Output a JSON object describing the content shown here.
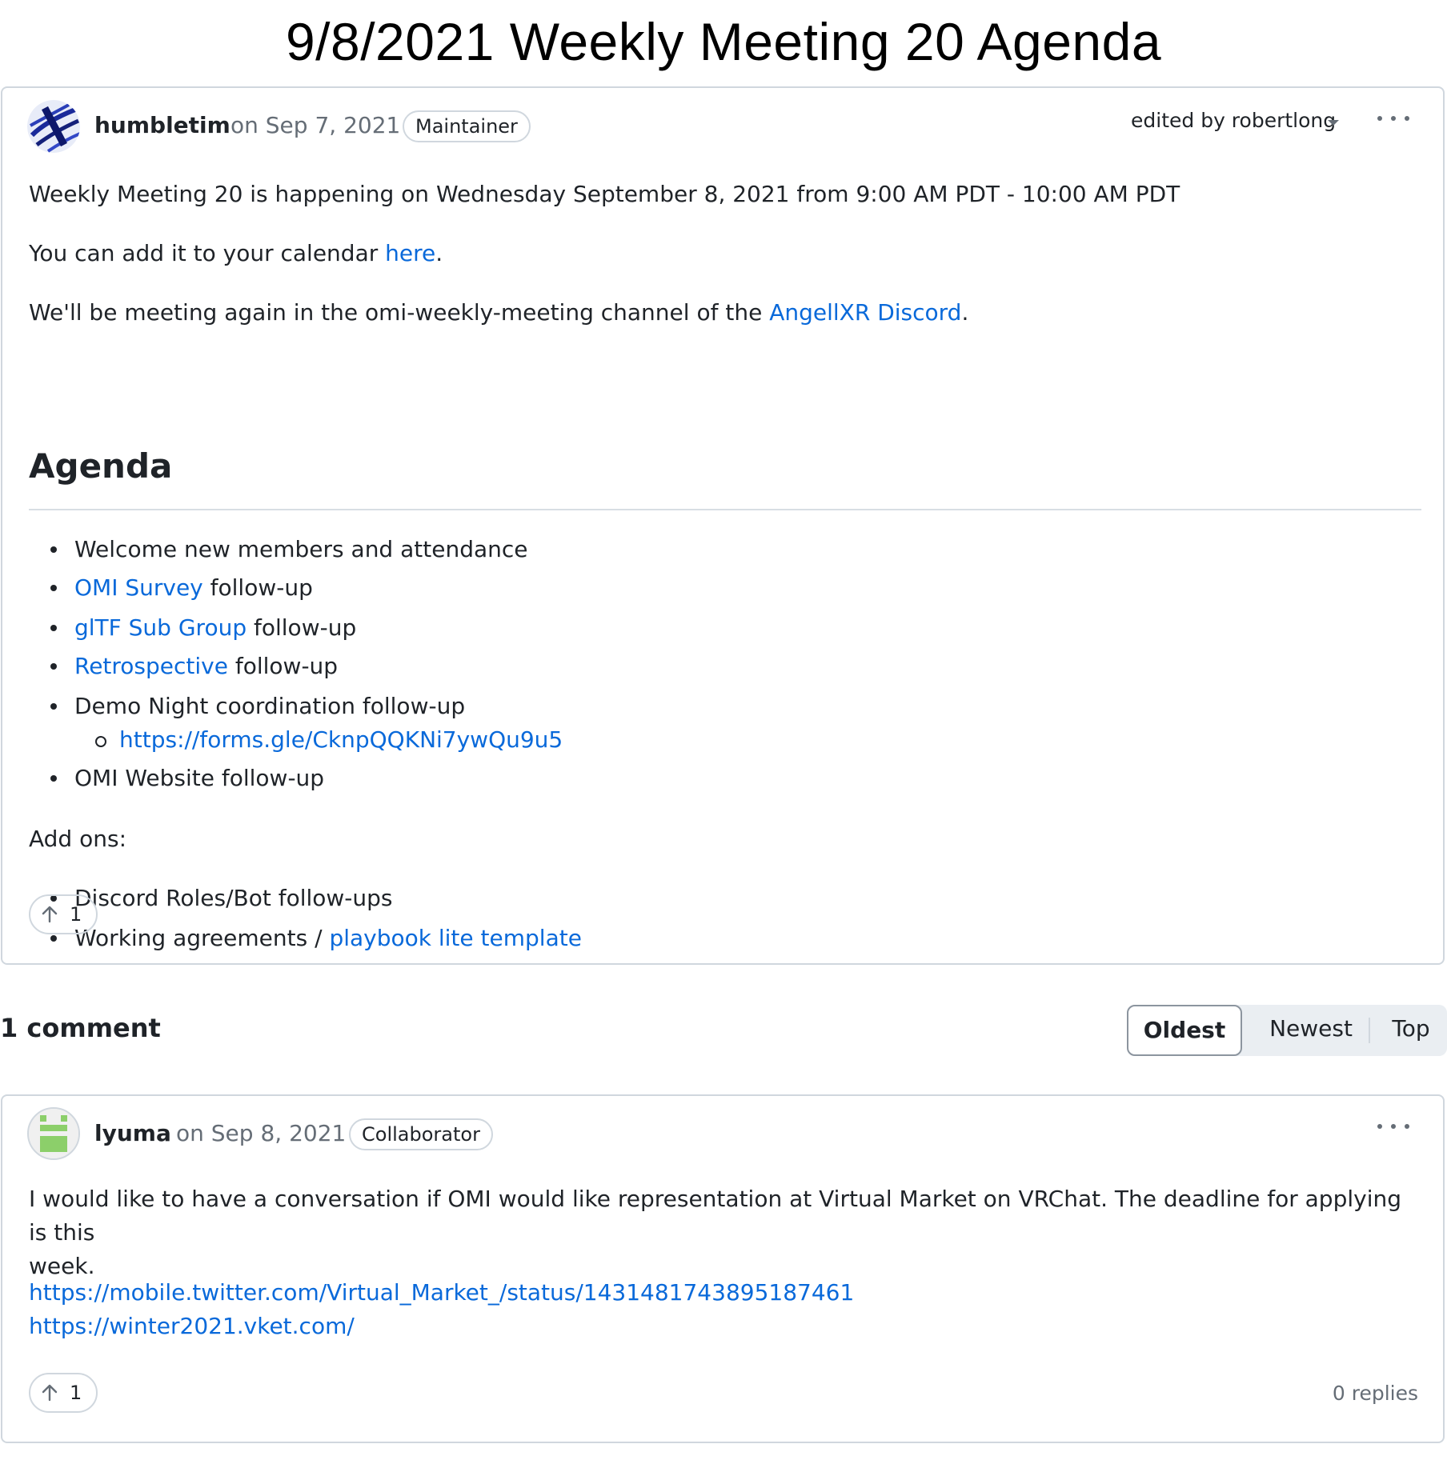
{
  "page": {
    "title": "9/8/2021 Weekly Meeting 20 Agenda"
  },
  "post": {
    "author": "humbletim",
    "date": "on Sep 7, 2021",
    "role": "Maintainer",
    "edited_by": "edited by robertlong",
    "intro": "Weekly Meeting 20 is happening on Wednesday September 8, 2021 from 9:00 AM PDT - 10:00 AM PDT",
    "calendar_text": "You can add it to your calendar ",
    "calendar_link": "here",
    "calendar_end": ".",
    "channel_text": "We'll be meeting again in the omi-weekly-meeting channel of the ",
    "channel_link": "AngellXR Discord",
    "channel_end": ".",
    "agenda_heading": "Agenda",
    "agenda": [
      {
        "text": "Welcome new members and attendance"
      },
      {
        "link": "OMI Survey",
        "text": " follow-up"
      },
      {
        "link": "glTF Sub Group",
        "text": " follow-up"
      },
      {
        "link": "Retrospective",
        "text": " follow-up"
      },
      {
        "text": "Demo Night coordination follow-up",
        "sub_link": "https://forms.gle/CknpQQKNi7ywQu9u5"
      },
      {
        "text": "OMI Website follow-up"
      }
    ],
    "addons_label": "Add ons:",
    "addons": [
      {
        "text": "Discord Roles/Bot follow-ups"
      },
      {
        "text": "Working agreements / ",
        "link": "playbook lite template"
      }
    ],
    "upvotes": "1"
  },
  "comments_section": {
    "title": "1 comment",
    "sort": {
      "oldest": "Oldest",
      "newest": "Newest",
      "top": "Top",
      "selected": "Oldest"
    }
  },
  "comment": {
    "author": "lyuma",
    "date": "on Sep 8, 2021",
    "role": "Collaborator",
    "body_line1": "I would like to have a conversation if OMI would like representation at Virtual Market on VRChat. The deadline for applying is this",
    "body_line2": "week.",
    "link1": "https://mobile.twitter.com/Virtual_Market_/status/1431481743895187461",
    "link2": "https://winter2021.vket.com/",
    "upvotes": "1",
    "replies": "0 replies"
  },
  "colors": {
    "link": "#0969da",
    "border": "#d0d7de",
    "muted": "#656d76",
    "text": "#1f2328"
  },
  "icons": [
    "kebab-menu-icon",
    "caret-down-icon",
    "arrow-up-icon"
  ]
}
